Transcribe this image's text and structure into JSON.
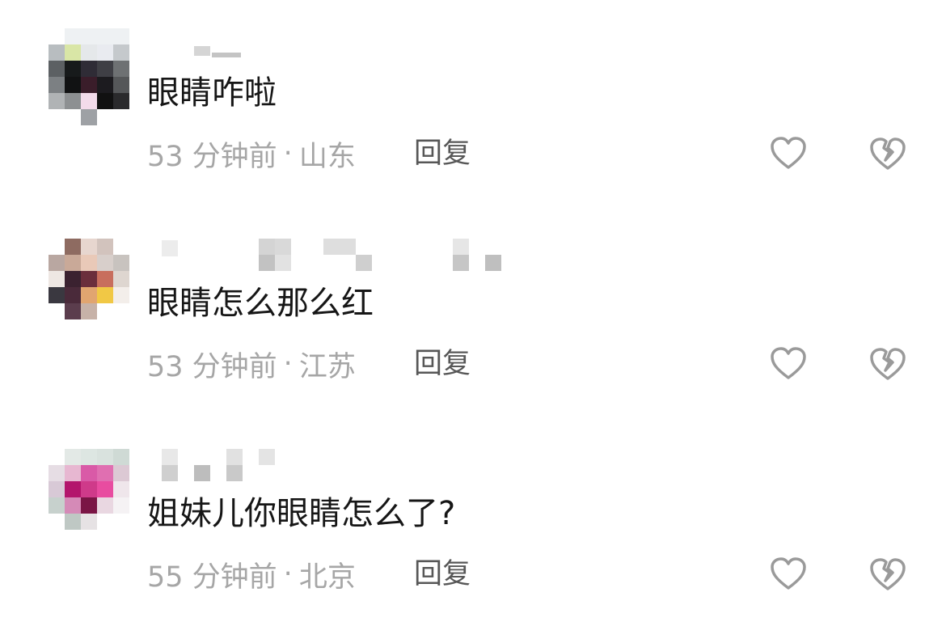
{
  "comments": [
    {
      "text": "眼睛咋啦",
      "time": "53 分钟前",
      "location": "山东",
      "reply_label": "回复"
    },
    {
      "text": "眼睛怎么那么红",
      "time": "53 分钟前",
      "location": "江苏",
      "reply_label": "回复"
    },
    {
      "text": "姐妹儿你眼睛怎么了?",
      "time": "55 分钟前",
      "location": "北京",
      "reply_label": "回复"
    }
  ],
  "separator": "·",
  "icons": {
    "like": "heart-outline-icon",
    "dislike": "broken-heart-icon"
  },
  "colors": {
    "comment_text": "#161616",
    "meta_text": "#a6a6a6",
    "reply_text": "#575757",
    "icon_stroke": "#9a9a9a"
  }
}
